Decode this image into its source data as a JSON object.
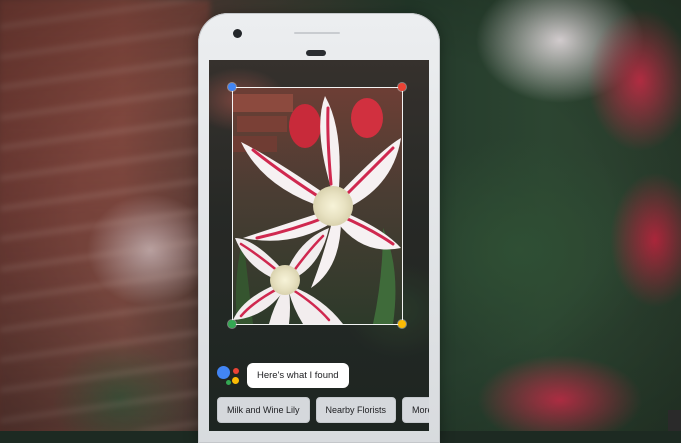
{
  "assistant": {
    "response_text": "Here's what I found",
    "logo_colors": [
      "#4285F4",
      "#EA4335",
      "#FBBC05",
      "#34A853"
    ]
  },
  "suggestions": [
    {
      "label": "Milk and Wine Lily"
    },
    {
      "label": "Nearby Florists"
    },
    {
      "label": "More Ir"
    }
  ],
  "selection": {
    "handle_colors": {
      "top_left": "#4285F4",
      "top_right": "#EA4335",
      "bottom_left": "#34A853",
      "bottom_right": "#FBBC05"
    }
  },
  "colors": {
    "phone_body": "#E3E5E8",
    "chip_background": "#D5D8DC",
    "bubble_background": "#FFFFFF"
  }
}
